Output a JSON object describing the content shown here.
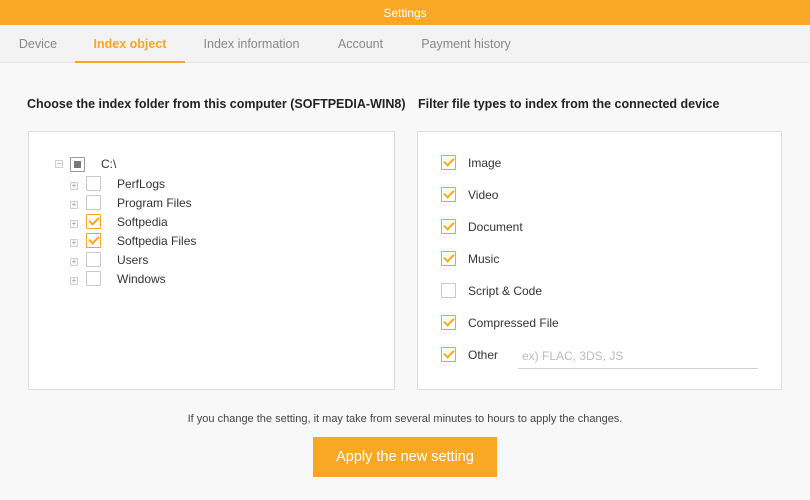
{
  "window": {
    "title": "Settings"
  },
  "tabs": [
    {
      "label": "Device",
      "active": false
    },
    {
      "label": "Index object",
      "active": true
    },
    {
      "label": "Index information",
      "active": false
    },
    {
      "label": "Account",
      "active": false
    },
    {
      "label": "Payment history",
      "active": false
    }
  ],
  "left": {
    "title": "Choose the index folder from this computer (SOFTPEDIA-WIN8)",
    "tree": {
      "root": {
        "label": "C:\\",
        "state": "partial"
      },
      "children": [
        {
          "label": "PerfLogs",
          "checked": false
        },
        {
          "label": "Program Files",
          "checked": false
        },
        {
          "label": "Softpedia",
          "checked": true
        },
        {
          "label": "Softpedia Files",
          "checked": true
        },
        {
          "label": "Users",
          "checked": false
        },
        {
          "label": "Windows",
          "checked": false
        }
      ]
    }
  },
  "right": {
    "title": "Filter file types to index from the connected device",
    "types": [
      {
        "label": "Image",
        "checked": true
      },
      {
        "label": "Video",
        "checked": true
      },
      {
        "label": "Document",
        "checked": true
      },
      {
        "label": "Music",
        "checked": true
      },
      {
        "label": "Script & Code",
        "checked": false
      },
      {
        "label": "Compressed File",
        "checked": true
      },
      {
        "label": "Other",
        "checked": true
      }
    ],
    "other_placeholder": "ex) FLAC, 3DS, JS",
    "other_value": ""
  },
  "footer": {
    "notice": "If you change the setting, it may take from several minutes to hours to apply the changes.",
    "apply_label": "Apply the new setting"
  },
  "colors": {
    "accent": "#f5a623",
    "titlebar": "#f9a825"
  }
}
